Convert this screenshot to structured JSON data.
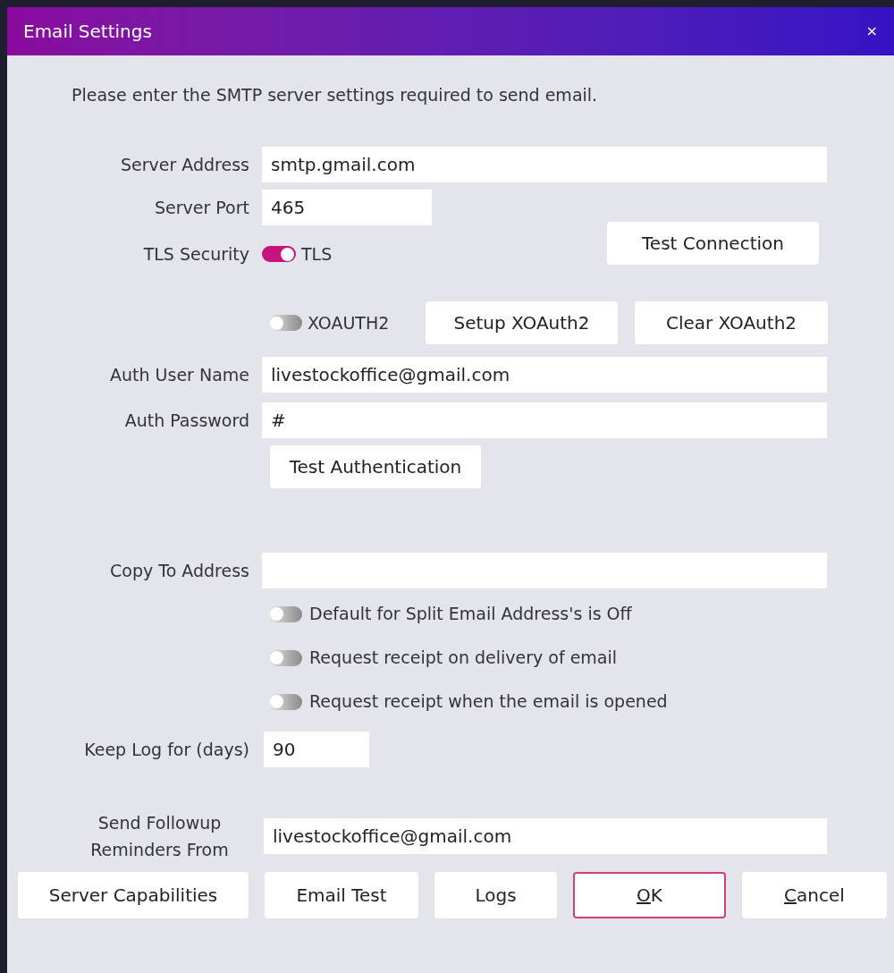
{
  "window": {
    "title": "Email Settings",
    "close": "×"
  },
  "intro": "Please enter the SMTP server settings required to send email.",
  "server_address": {
    "label": "Server Address",
    "value": "smtp.gmail.com"
  },
  "server_port": {
    "label": "Server Port",
    "value": "465"
  },
  "tls": {
    "label": "TLS Security",
    "toggle_label": "TLS",
    "on": true
  },
  "test_connection": "Test Connection",
  "xoauth2": {
    "toggle_label": "XOAUTH2",
    "on": false
  },
  "setup_xoauth2": "Setup XOAuth2",
  "clear_xoauth2": "Clear XOAuth2",
  "auth_user_name": {
    "label": "Auth User Name",
    "value": "livestockoffice@gmail.com"
  },
  "auth_password": {
    "label": "Auth Password",
    "value": "#"
  },
  "test_authentication": "Test Authentication",
  "copy_to_address": {
    "label": "Copy To Address"
  },
  "options": [
    {
      "label": "Default for Split Email Address's is Off",
      "on": false
    },
    {
      "label": "Request receipt on delivery of email",
      "on": false
    },
    {
      "label": "Request receipt when the email is opened",
      "on": false
    }
  ],
  "keep_log": {
    "label": "Keep Log for (days)",
    "value": "90"
  },
  "followup": {
    "label_lines": [
      "Send Followup",
      "Reminders From"
    ],
    "value": "livestockoffice@gmail.com"
  },
  "buttons": [
    {
      "label": "Server Capabilities",
      "default": false,
      "access_key": false
    },
    {
      "label": "Email Test",
      "default": false,
      "access_key": false
    },
    {
      "label": "Logs",
      "default": false,
      "access_key": false
    },
    {
      "label": "OK",
      "default": true,
      "access_key": true
    },
    {
      "label": "Cancel",
      "default": false,
      "access_key": true
    }
  ]
}
